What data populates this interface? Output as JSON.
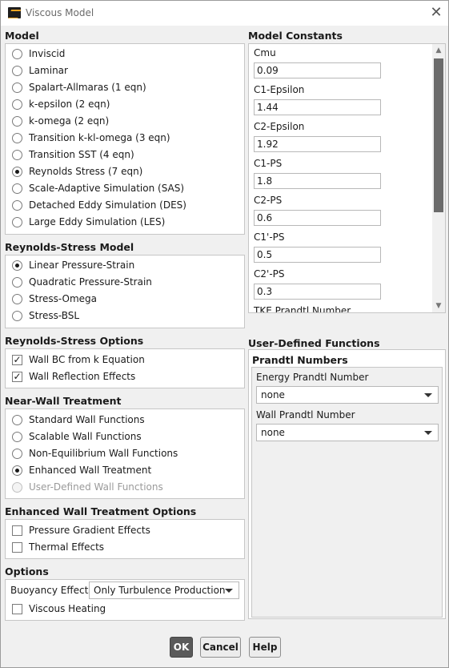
{
  "window": {
    "title": "Viscous Model",
    "close_symbol": "✕"
  },
  "model": {
    "title": "Model",
    "options": [
      {
        "label": "Inviscid",
        "selected": false
      },
      {
        "label": "Laminar",
        "selected": false
      },
      {
        "label": "Spalart-Allmaras (1 eqn)",
        "selected": false
      },
      {
        "label": "k-epsilon (2 eqn)",
        "selected": false
      },
      {
        "label": "k-omega (2 eqn)",
        "selected": false
      },
      {
        "label": "Transition k-kl-omega (3 eqn)",
        "selected": false
      },
      {
        "label": "Transition SST (4 eqn)",
        "selected": false
      },
      {
        "label": "Reynolds Stress (7 eqn)",
        "selected": true
      },
      {
        "label": "Scale-Adaptive Simulation (SAS)",
        "selected": false
      },
      {
        "label": "Detached Eddy Simulation (DES)",
        "selected": false
      },
      {
        "label": "Large Eddy Simulation (LES)",
        "selected": false
      }
    ]
  },
  "rs_model": {
    "title": "Reynolds-Stress Model",
    "options": [
      {
        "label": "Linear Pressure-Strain",
        "selected": true
      },
      {
        "label": "Quadratic Pressure-Strain",
        "selected": false
      },
      {
        "label": "Stress-Omega",
        "selected": false
      },
      {
        "label": "Stress-BSL",
        "selected": false
      }
    ]
  },
  "rs_options": {
    "title": "Reynolds-Stress Options",
    "items": [
      {
        "label": "Wall BC from k Equation",
        "checked": true
      },
      {
        "label": "Wall Reflection Effects",
        "checked": true
      }
    ]
  },
  "near_wall": {
    "title": "Near-Wall Treatment",
    "options": [
      {
        "label": "Standard Wall Functions",
        "selected": false
      },
      {
        "label": "Scalable Wall Functions",
        "selected": false
      },
      {
        "label": "Non-Equilibrium Wall Functions",
        "selected": false
      },
      {
        "label": "Enhanced Wall Treatment",
        "selected": true
      },
      {
        "label": "User-Defined Wall Functions",
        "selected": false,
        "disabled": true
      }
    ]
  },
  "ewt_options": {
    "title": "Enhanced Wall Treatment Options",
    "items": [
      {
        "label": "Pressure Gradient Effects",
        "checked": false
      },
      {
        "label": "Thermal Effects",
        "checked": false
      }
    ]
  },
  "options": {
    "title": "Options",
    "buoyancy_label": "Buoyancy Effects",
    "buoyancy_value": "Only Turbulence Production",
    "viscous_heating_label": "Viscous Heating",
    "viscous_heating_checked": false
  },
  "model_constants": {
    "title": "Model Constants",
    "items": [
      {
        "label": "Cmu",
        "value": "0.09"
      },
      {
        "label": "C1-Epsilon",
        "value": "1.44"
      },
      {
        "label": "C2-Epsilon",
        "value": "1.92"
      },
      {
        "label": "C1-PS",
        "value": "1.8"
      },
      {
        "label": "C2-PS",
        "value": "0.6"
      },
      {
        "label": "C1'-PS",
        "value": "0.5"
      },
      {
        "label": "C2'-PS",
        "value": "0.3"
      },
      {
        "label": "TKE Prandtl Number",
        "value": ""
      }
    ]
  },
  "udf": {
    "title": "User-Defined Functions",
    "prandtl_title": "Prandtl Numbers",
    "energy_label": "Energy Prandtl Number",
    "energy_value": "none",
    "wall_label": "Wall Prandtl Number",
    "wall_value": "none"
  },
  "buttons": {
    "ok": "OK",
    "cancel": "Cancel",
    "help": "Help"
  }
}
